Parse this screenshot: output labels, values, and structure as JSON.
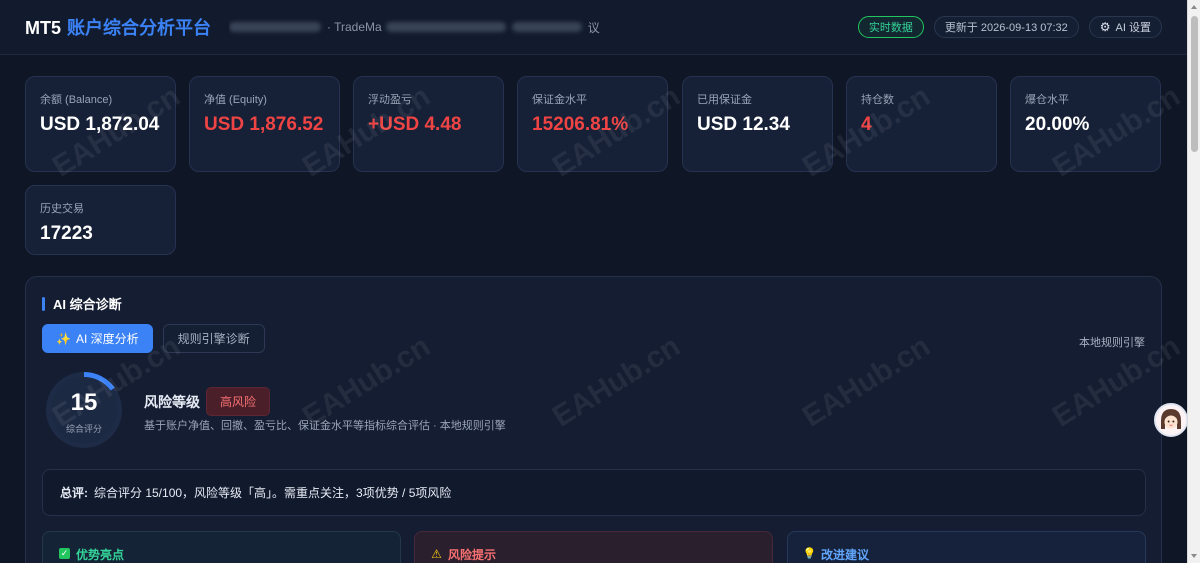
{
  "header": {
    "brand_prefix": "MT5",
    "brand_title": "账户综合分析平台",
    "account_visible": "· TradeMa",
    "account_suffix": "议",
    "live_label": "实时数据",
    "updated_label": "更新于 2026-09-13 07:32",
    "ai_settings_label": "AI 设置"
  },
  "metrics": [
    {
      "label": "余额 (Balance)",
      "value": "USD 1,872.04",
      "color": "#ffffff"
    },
    {
      "label": "净值 (Equity)",
      "value": "USD 1,876.52",
      "color": "#ef4444"
    },
    {
      "label": "浮动盈亏",
      "value": "+USD 4.48",
      "color": "#ef4444"
    },
    {
      "label": "保证金水平",
      "value": "15206.81%",
      "color": "#ef4444"
    },
    {
      "label": "已用保证金",
      "value": "USD 12.34",
      "color": "#ffffff"
    },
    {
      "label": "持仓数",
      "value": "4",
      "color": "#ef4444"
    },
    {
      "label": "爆仓水平",
      "value": "20.00%",
      "color": "#ffffff"
    },
    {
      "label": "历史交易",
      "value": "17223",
      "color": "#ffffff"
    }
  ],
  "diagnosis": {
    "title": "AI 综合诊断",
    "tab_ai": "AI 深度分析",
    "tab_rules": "规则引擎诊断",
    "engine_label": "本地规则引擎",
    "score": "15",
    "score_fraction": 0.15,
    "score_label": "综合评分",
    "risk_label": "风险等级",
    "risk_badge": "高风险",
    "risk_desc": "基于账户净值、回撤、盈亏比、保证金水平等指标综合评估 · 本地规则引擎",
    "summary_label": "总评:",
    "summary_text": "综合评分 15/100，风险等级「高」。需重点关注，3项优势 / 5项风险",
    "strengths_title": "优势亮点",
    "risks_title": "风险提示",
    "suggestions_title": "改进建议"
  },
  "watermark": "EAHub.cn",
  "colors": {
    "accent": "#3b82f6",
    "danger": "#ef4444",
    "success": "#22c55e"
  }
}
